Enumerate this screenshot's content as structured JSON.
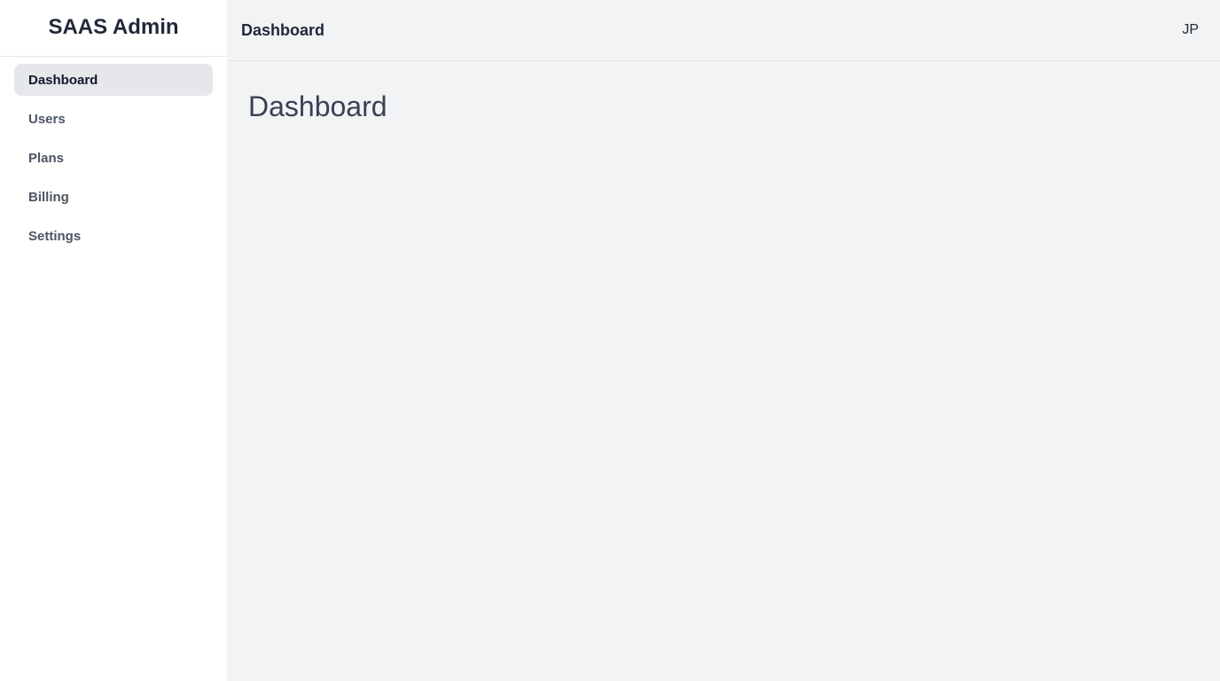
{
  "sidebar": {
    "brand": "SAAS Admin",
    "items": [
      {
        "label": "Dashboard",
        "active": true
      },
      {
        "label": "Users",
        "active": false
      },
      {
        "label": "Plans",
        "active": false
      },
      {
        "label": "Billing",
        "active": false
      },
      {
        "label": "Settings",
        "active": false
      }
    ]
  },
  "header": {
    "title": "Dashboard",
    "user_initials": "JP"
  },
  "main": {
    "page_title": "Dashboard"
  },
  "colors": {
    "sidebar_bg": "#ffffff",
    "main_bg": "#f1f3f5",
    "active_item_bg": "#e5e7eb",
    "text_primary": "#1f2937"
  }
}
